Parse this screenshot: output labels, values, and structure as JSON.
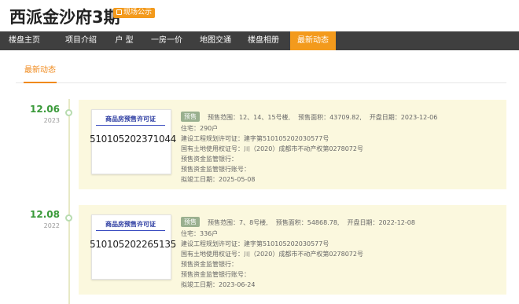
{
  "header": {
    "title": "西派金沙府3期",
    "badge": "现场公示"
  },
  "nav": {
    "items": [
      {
        "label": "楼盘主页"
      },
      {
        "label": "项目介绍"
      },
      {
        "label": "户 型"
      },
      {
        "label": "一房一价"
      },
      {
        "label": "地图交通"
      },
      {
        "label": "楼盘相册"
      },
      {
        "label": "最新动态",
        "active": true
      }
    ]
  },
  "subtabs": {
    "active": "最新动态"
  },
  "timeline": [
    {
      "date": "12.06",
      "year": "2023",
      "cert": {
        "title": "商品房预售许可证",
        "number": "510105202371044"
      },
      "tag": "预售",
      "range": "预售范围：12、14、15号楼,",
      "area": "预售面积：43709.82,",
      "open_date": "开盘日期：2023-12-06",
      "details": [
        "住宅：290户",
        "建设工程规划许可证：建字第510105202030577号",
        "国有土地使用权证号：川（2020）成都市不动产权第0278072号",
        "预售资金监管银行：",
        "预售资金监管银行账号：",
        "拟竣工日期：2025-05-08"
      ]
    },
    {
      "date": "12.08",
      "year": "2022",
      "cert": {
        "title": "商品房预售许可证",
        "number": "510105202265135"
      },
      "tag": "预售",
      "range": "预售范围：7、8号楼,",
      "area": "预售面积：54868.78,",
      "open_date": "开盘日期：2022-12-08",
      "details": [
        "住宅：336户",
        "建设工程规划许可证：建字第510105202030577号",
        "国有土地使用权证号：川（2020）成都市不动产权第0278072号",
        "预售资金监管银行：",
        "预售资金监管银行账号：",
        "拟竣工日期：2023-06-24"
      ]
    }
  ],
  "colors": {
    "accent": "#f39a1c",
    "nav_bg": "#3f3f3f",
    "date_green": "#3a9a3a",
    "card_bg": "#fbf8de",
    "tag_bg": "#9ab08f",
    "cert_blue": "#2a3aa0"
  }
}
